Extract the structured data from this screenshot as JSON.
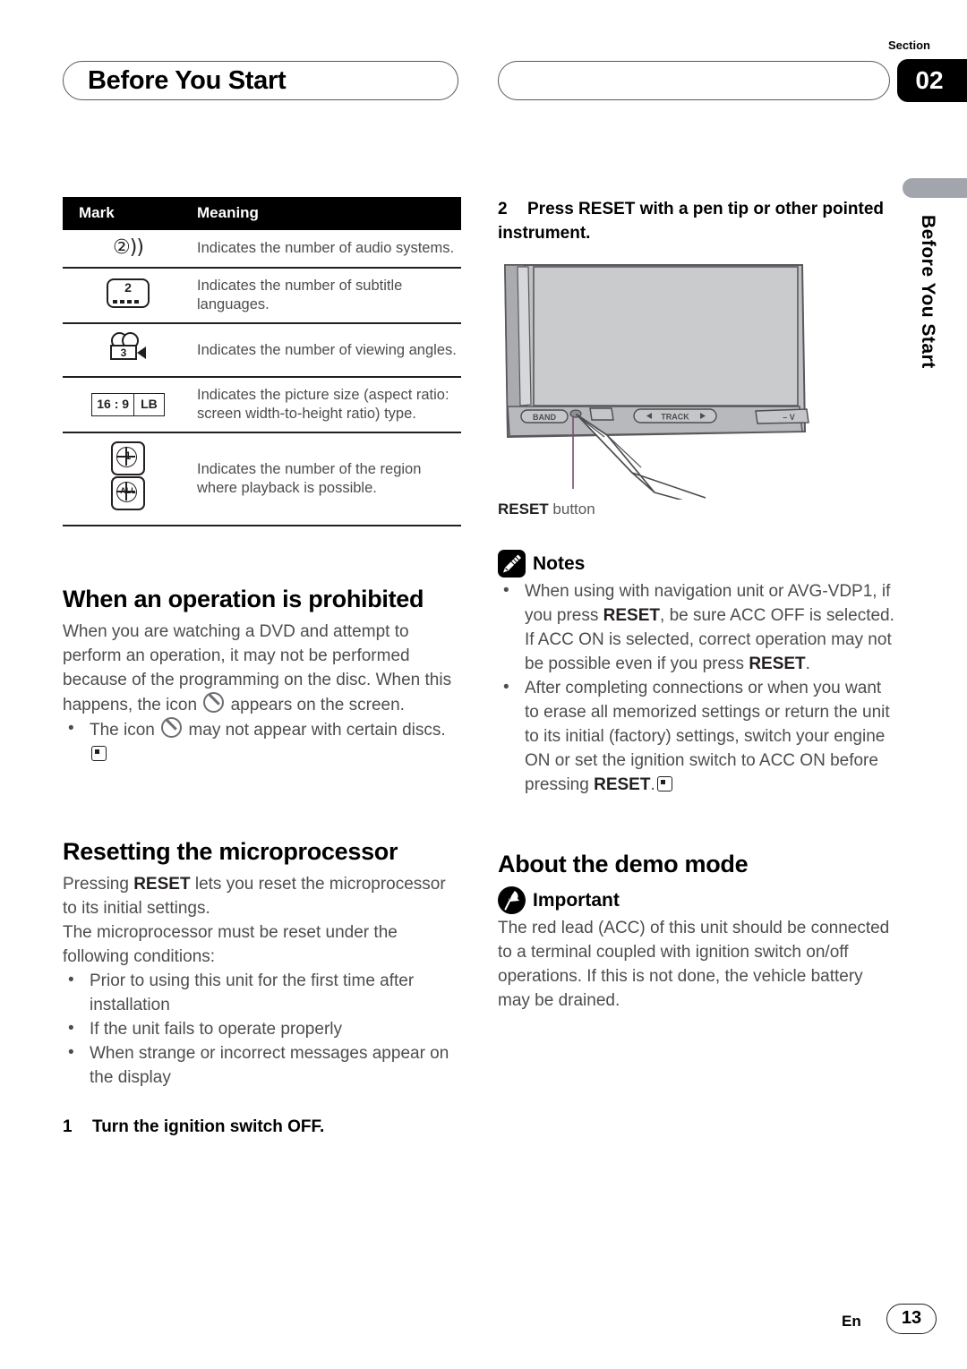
{
  "header": {
    "title": "Before You Start",
    "section_word": "Section",
    "section_number": "02"
  },
  "side_tab": {
    "label": "Before You Start"
  },
  "mark_table": {
    "columns": [
      "Mark",
      "Meaning"
    ],
    "rows": [
      {
        "mark_icon": "audio-systems-icon",
        "mark_value": "2",
        "meaning": "Indicates the number of audio systems."
      },
      {
        "mark_icon": "subtitle-languages-icon",
        "mark_value": "2",
        "meaning": "Indicates the number of subtitle languages."
      },
      {
        "mark_icon": "viewing-angles-icon",
        "mark_value": "3",
        "meaning": "Indicates the number of viewing angles."
      },
      {
        "mark_icon": "aspect-ratio-icon",
        "mark_value": "16 : 9",
        "mark_value2": "LB",
        "meaning": "Indicates the picture size (aspect ratio: screen width-to-height ratio) type."
      },
      {
        "mark_icon": "region-code-icon",
        "mark_value": "1",
        "mark_value2": "ALL",
        "meaning": "Indicates the number of the region where playback is possible."
      }
    ]
  },
  "prohibited": {
    "heading": "When an operation is prohibited",
    "para_a": "When you are watching a DVD and attempt to perform an operation, it may not be performed because of the programming on the disc. When this happens, the icon",
    "para_b": "appears on the screen.",
    "bullet_a": "The icon",
    "bullet_b": "may not appear with certain discs."
  },
  "resetting": {
    "heading": "Resetting the microprocessor",
    "para1_a": "Pressing",
    "para1_reset": "RESET",
    "para1_b": "lets you reset the microprocessor to its initial settings.",
    "para2": "The microprocessor must be reset under the following conditions:",
    "bullets": [
      "Prior to using this unit for the first time after installation",
      "If the unit fails to operate properly",
      "When strange or incorrect messages appear on the display"
    ],
    "step1_num": "1",
    "step1_text": "Turn the ignition switch OFF."
  },
  "press_reset": {
    "step2_num": "2",
    "step2_text": "Press RESET with a pen tip or other pointed instrument.",
    "figure": {
      "band_label": "BAND",
      "track_label": "TRACK",
      "volume_label": "– V",
      "caption_bold": "RESET",
      "caption_rest": " button"
    }
  },
  "notes": {
    "label": "Notes",
    "items": [
      {
        "part1": "When using with navigation unit or AVG-VDP1, if you press ",
        "bold1": "RESET",
        "part2": ", be sure ACC OFF is selected. If ACC ON is selected, correct operation may not be possible even if you press ",
        "bold2": "RESET",
        "part3": "."
      },
      {
        "part1": "After completing connections or when you want to erase all memorized settings or return the unit to its initial (factory) settings, switch your engine ON or set the ignition switch to ACC ON before pressing ",
        "bold1": "RESET",
        "part2": ".",
        "end_marker": true
      }
    ]
  },
  "demo_mode": {
    "heading": "About the demo mode",
    "important_label": "Important",
    "body": "The red lead (ACC) of this unit should be connected to a terminal coupled with ignition switch on/off operations. If this is not done, the vehicle battery may be drained."
  },
  "footer": {
    "lang": "En",
    "page": "13"
  }
}
